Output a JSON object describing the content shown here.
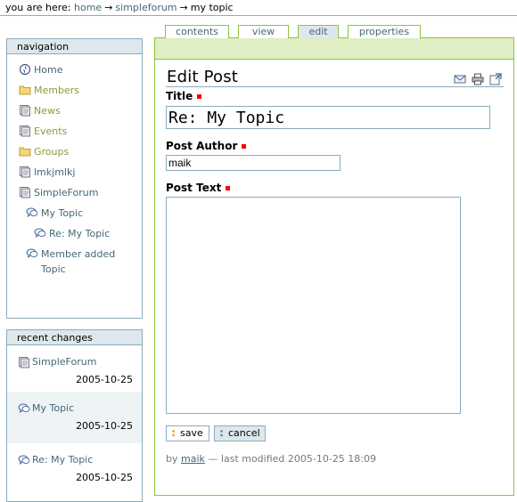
{
  "breadcrumb": {
    "prefix": "you are here:",
    "items": [
      "home",
      "simpleforum",
      "my topic"
    ],
    "separator": "→"
  },
  "navigation": {
    "title": "navigation",
    "items": [
      {
        "label": "Home",
        "icon": "home-icon"
      },
      {
        "label": "Members",
        "icon": "folder-icon"
      },
      {
        "label": "News",
        "icon": "topic-icon"
      },
      {
        "label": "Events",
        "icon": "topic-icon"
      },
      {
        "label": "Groups",
        "icon": "folder-icon"
      },
      {
        "label": "lmkjmlkj",
        "icon": "document-icon"
      },
      {
        "label": "SimpleForum",
        "icon": "document-icon"
      },
      {
        "label": "My Topic",
        "icon": "comment-icon"
      },
      {
        "label": "Re: My Topic",
        "icon": "comment-icon"
      },
      {
        "label": "Member added Topic",
        "icon": "comment-icon"
      }
    ]
  },
  "recent_changes": {
    "title": "recent changes",
    "items": [
      {
        "label": "SimpleForum",
        "date": "2005-10-25",
        "icon": "document-icon"
      },
      {
        "label": "My Topic",
        "date": "2005-10-25",
        "icon": "comment-icon"
      },
      {
        "label": "Re: My Topic",
        "date": "2005-10-25",
        "icon": "comment-icon"
      }
    ]
  },
  "tabs": [
    {
      "label": "contents",
      "active": false
    },
    {
      "label": "view",
      "active": false
    },
    {
      "label": "edit",
      "active": true
    },
    {
      "label": "properties",
      "active": false
    }
  ],
  "page": {
    "title": "Edit Post",
    "actions": [
      "mail-icon",
      "print-icon",
      "fullscreen-icon"
    ]
  },
  "form": {
    "title_label": "Title",
    "title_value": "Re: My Topic",
    "author_label": "Post Author",
    "author_value": "maik",
    "text_label": "Post Text",
    "text_value": "",
    "save_label": "save",
    "cancel_label": "cancel"
  },
  "byline": {
    "prefix": "by",
    "author": "maik",
    "suffix": "— last modified 2005-10-25 18:09"
  },
  "colors": {
    "link": "#436976",
    "portlet_header_bg": "#dee7ec",
    "border": "#8cacbb",
    "content_border": "#8cc63f",
    "content_bar": "#dfeec3",
    "required": "#ff0000"
  }
}
